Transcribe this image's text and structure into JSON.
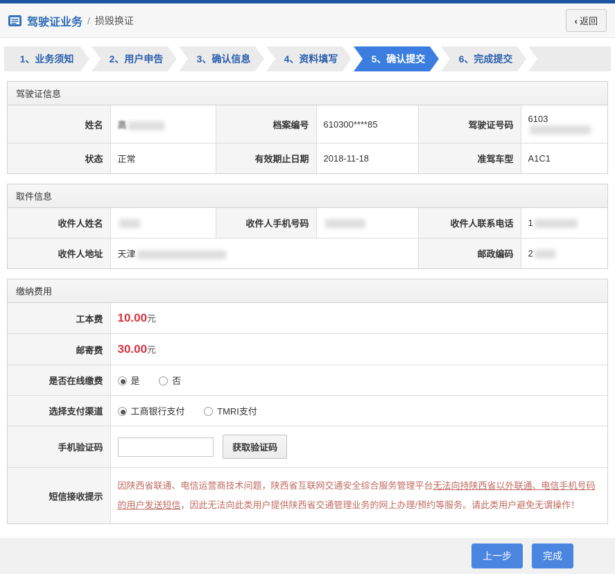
{
  "header": {
    "title": "驾驶证业务",
    "separator": "/",
    "subtitle": "损毁换证",
    "back_icon": "‹",
    "back_label": "返回"
  },
  "steps": [
    {
      "label": "1、业务须知",
      "active": false
    },
    {
      "label": "2、用户申告",
      "active": false
    },
    {
      "label": "3、确认信息",
      "active": false
    },
    {
      "label": "4、资料填写",
      "active": false
    },
    {
      "label": "5、确认提交",
      "active": true
    },
    {
      "label": "6、完成提交",
      "active": false
    }
  ],
  "license_info": {
    "title": "驾驶证信息",
    "name_label": "姓名",
    "name_value_prefix": "高",
    "file_no_label": "档案编号",
    "file_no_value": "610300****85",
    "license_no_label": "驾驶证号码",
    "license_no_prefix": "6103",
    "status_label": "状态",
    "status_value": "正常",
    "expiry_label": "有效期止日期",
    "expiry_value": "2018-11-18",
    "vehicle_label": "准驾车型",
    "vehicle_value": "A1C1"
  },
  "pickup_info": {
    "title": "取件信息",
    "recipient_name_label": "收件人姓名",
    "recipient_mobile_label": "收件人手机号码",
    "recipient_phone_label": "收件人联系电话",
    "recipient_phone_prefix": "1",
    "recipient_address_label": "收件人地址",
    "recipient_address_prefix": "天津",
    "postal_code_label": "邮政编码",
    "postal_code_prefix": "2"
  },
  "payment": {
    "title": "缴纳费用",
    "production_fee_label": "工本费",
    "production_fee": "10.00",
    "postage_fee_label": "邮寄费",
    "postage_fee": "30.00",
    "fee_unit": "元",
    "online_payment_label": "是否在线缴费",
    "online_yes": "是",
    "online_no": "否",
    "online_selected": "是",
    "channel_label": "选择支付渠道",
    "channel_icbc": "工商银行支付",
    "channel_tmri": "TMRI支付",
    "channel_selected": "工商银行支付",
    "sms_code_label": "手机验证码",
    "sms_code_value": "",
    "get_code_button": "获取验证码",
    "sms_notice_label": "短信接收提示",
    "sms_notice_part1": "因陕西省联通、电信运营商技术问题，陕西省互联网交通安全综合服务管理平台",
    "sms_notice_underlined": "无法向持陕西省以外联通、电信手机号码的用户发送短信",
    "sms_notice_part2": "，因此无法向此类用户提供陕西省交通管理业务的网上办理/预约等服务。请此类用户避免无谓操作！"
  },
  "footer": {
    "prev_button": "上一步",
    "finish_button": "完成"
  },
  "colors": {
    "top_bar_blue": "#1d53a3",
    "active_step_blue": "#3c7ee0",
    "step_text_blue": "#2a5fae",
    "title_blue": "#2e6cb5",
    "fee_red": "#d9323f",
    "notice_red": "#bf6a62",
    "button_blue": "#4a85e0"
  }
}
